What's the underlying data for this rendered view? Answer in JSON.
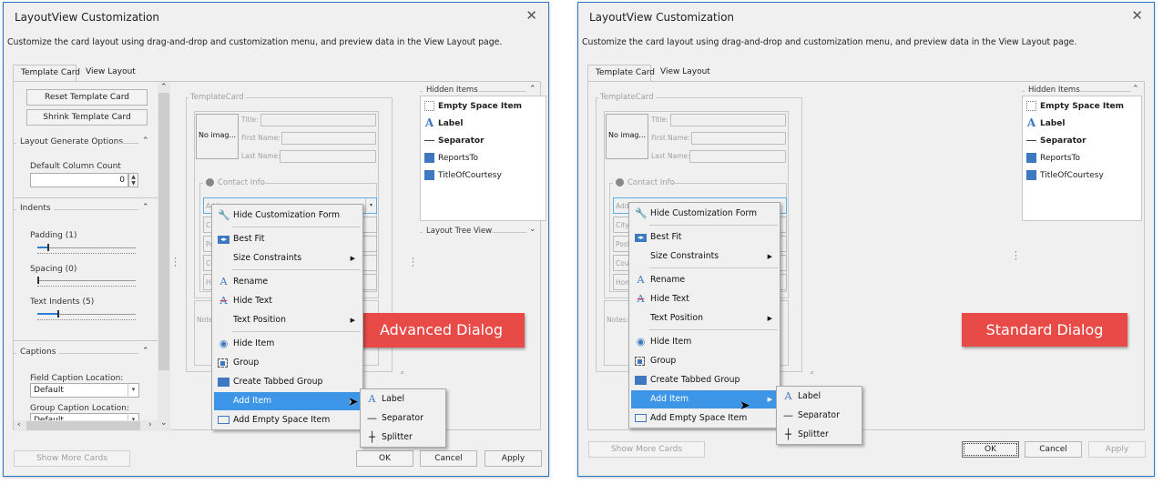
{
  "dialogs": [
    {
      "id": "advanced",
      "title": "LayoutView Customization",
      "description": "Customize the card layout using drag-and-drop and customization menu, and preview data in the View Layout page.",
      "tabs": [
        {
          "label": "Template Card",
          "active": true
        },
        {
          "label": "View Layout",
          "active": false
        }
      ],
      "left_panel": {
        "reset_button": "Reset Template Card",
        "shrink_button": "Shrink Template Card",
        "layout_options": {
          "header": "Layout Generate Options",
          "default_column_count_label": "Default Column Count",
          "default_column_count_value": "0"
        },
        "indents": {
          "header": "Indents",
          "padding_label": "Padding (1)",
          "padding_value": 1,
          "spacing_label": "Spacing (0)",
          "spacing_value": 0,
          "text_indents_label": "Text Indents (5)",
          "text_indents_value": 5
        },
        "captions": {
          "header": "Captions",
          "field_caption_label": "Field Caption Location:",
          "field_caption_value": "Default",
          "group_caption_label": "Group Caption Location:",
          "group_caption_value": "Default"
        }
      },
      "show_more_cards": "Show More Cards",
      "footer": {
        "ok": "OK",
        "cancel": "Cancel",
        "apply": "Apply"
      },
      "banner": "Advanced Dialog",
      "layout_tree_view": "Layout Tree View"
    },
    {
      "id": "standard",
      "title": "LayoutView Customization",
      "description": "Customize the card layout using drag-and-drop and customization menu, and preview data in the View Layout page.",
      "tabs": [
        {
          "label": "Template Card",
          "active": true
        },
        {
          "label": "View Layout",
          "active": false
        }
      ],
      "show_more_cards": "Show More Cards",
      "footer": {
        "ok": "OK",
        "cancel": "Cancel",
        "apply": "Apply"
      },
      "banner": "Standard Dialog"
    }
  ],
  "template_card": {
    "group_caption": "TemplateCard",
    "image_placeholder": "No imag...",
    "fields": [
      "Title:",
      "First Name:",
      "Last Name:"
    ],
    "contact_info": {
      "caption": "Contact Info",
      "fields_a": [
        "Address:",
        "City:",
        "Postal",
        "Cou",
        "Hom"
      ],
      "fields_b": [
        "Addre",
        "City:",
        "Postal",
        "Count",
        "Home"
      ]
    },
    "notes_label": "Notes:"
  },
  "hidden_items": {
    "header": "Hidden Items",
    "items": [
      {
        "label": "Empty Space Item",
        "icon": "empty-space-icon",
        "bold": true
      },
      {
        "label": "Label",
        "icon": "label-icon",
        "bold": true
      },
      {
        "label": "Separator",
        "icon": "separator-icon",
        "bold": true
      },
      {
        "label": "ReportsTo",
        "icon": "field-icon",
        "bold": false
      },
      {
        "label": "TitleOfCourtesy",
        "icon": "field-icon",
        "bold": false
      }
    ]
  },
  "context_menu": {
    "items": [
      {
        "label": "Hide Customization Form",
        "icon": "wrench-icon"
      },
      {
        "label": "Best Fit",
        "icon": "best-fit-icon"
      },
      {
        "label": "Size Constraints",
        "submenu": true
      },
      {
        "label": "Rename",
        "icon": "rename-icon"
      },
      {
        "label": "Hide Text",
        "icon": "hide-text-icon"
      },
      {
        "label": "Text Position",
        "submenu": true
      },
      {
        "label": "Hide Item",
        "icon": "hide-item-icon"
      },
      {
        "label": "Group",
        "icon": "group-icon"
      },
      {
        "label": "Create Tabbed Group",
        "icon": "folder-icon"
      },
      {
        "label": "Add Item",
        "submenu": true,
        "highlighted": true
      },
      {
        "label": "Add Empty Space Item",
        "icon": "empty-space-item-icon"
      }
    ],
    "submenu": [
      {
        "label": "Label",
        "icon": "label-icon"
      },
      {
        "label": "Separator",
        "icon": "separator-icon"
      },
      {
        "label": "Splitter",
        "icon": "splitter-icon"
      }
    ]
  },
  "colors": {
    "accent": "#2b79c7",
    "highlight": "#3d95e8",
    "banner": "#e84a47",
    "field_icon": "#3d78c1"
  }
}
